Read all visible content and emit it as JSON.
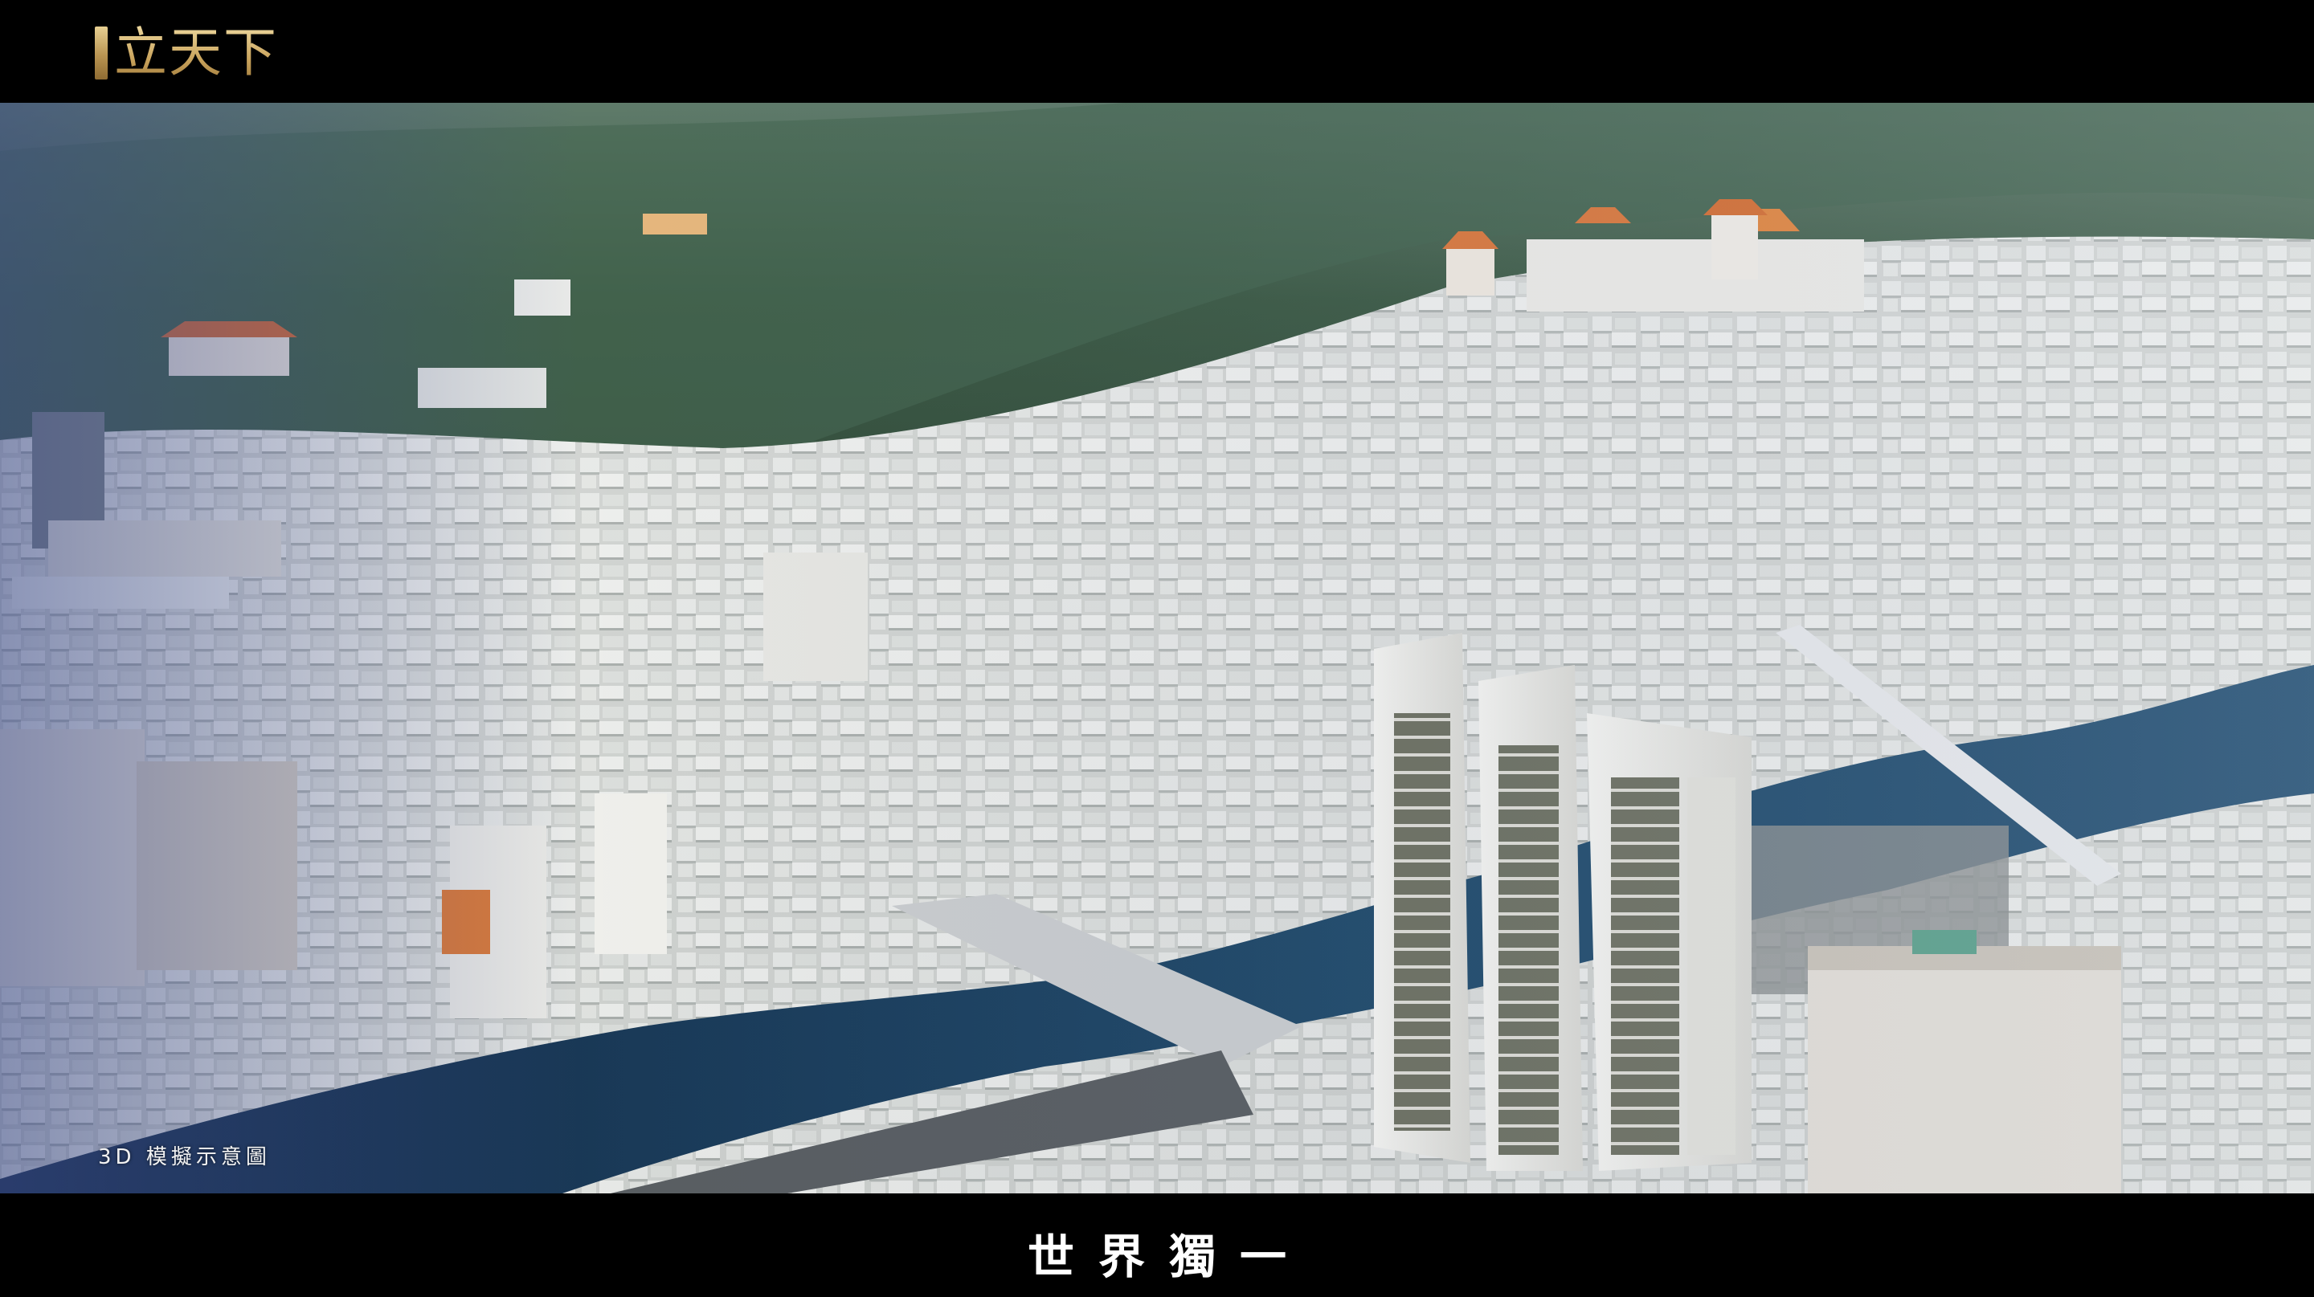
{
  "logo": {
    "text": "立天下",
    "colors": {
      "gold_light": "#f1dea6",
      "gold_dark": "#9c7739"
    }
  },
  "photo": {
    "caption": "3D 模擬示意圖"
  },
  "subtitle": {
    "text": "世界獨一"
  },
  "colors": {
    "letterbox": "#000000",
    "mountain": "#3a5540",
    "river": "#1f3f5c",
    "city": "#d9dbd8",
    "tower": "#eeeeea"
  }
}
